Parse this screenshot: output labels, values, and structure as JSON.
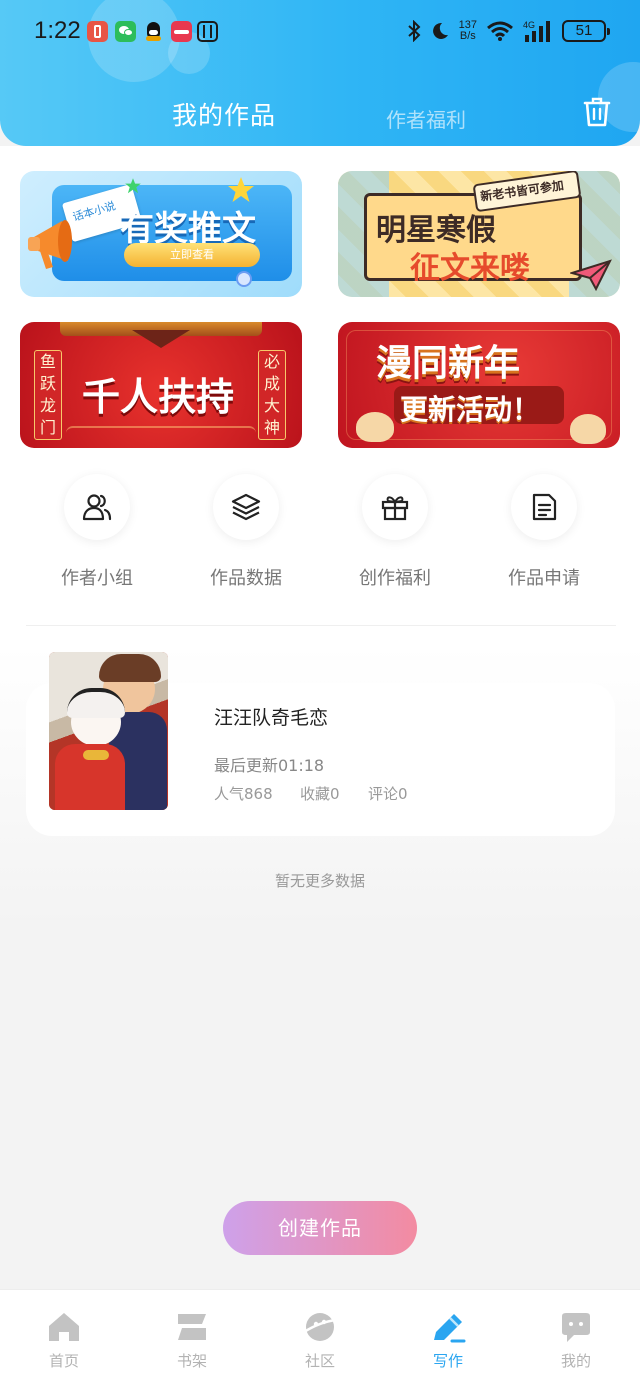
{
  "status_bar": {
    "time": "1:22",
    "net_speed_value": "137",
    "net_speed_unit": "B/s",
    "battery": "51"
  },
  "header": {
    "tabs": [
      {
        "label": "我的作品",
        "active": true
      },
      {
        "label": "作者福利",
        "active": false
      }
    ],
    "trash_icon": "trash-icon"
  },
  "banners": [
    {
      "title": "有奖推文",
      "tag": "话本小说",
      "button": "立即查看"
    },
    {
      "title_line1": "明星寒假",
      "title_line2": "征文来喽",
      "tag": "新老书皆可参加"
    },
    {
      "title": "千人扶持",
      "left_couplet": "鱼跃龙门",
      "right_couplet": "必成大神"
    },
    {
      "title_line1": "漫同新年",
      "title_line2": "更新活动！"
    }
  ],
  "quick_actions": [
    {
      "label": "作者小组",
      "icon": "users-icon"
    },
    {
      "label": "作品数据",
      "icon": "layers-icon"
    },
    {
      "label": "创作福利",
      "icon": "gift-icon"
    },
    {
      "label": "作品申请",
      "icon": "document-icon"
    }
  ],
  "work": {
    "title": "汪汪队奇毛恋",
    "last_update": "最后更新01:18",
    "popularity": "人气868",
    "favorites": "收藏0",
    "comments": "评论0"
  },
  "no_more_text": "暂无更多数据",
  "create_button": "创建作品",
  "tab_bar": [
    {
      "label": "首页",
      "icon": "home-icon"
    },
    {
      "label": "书架",
      "icon": "bookshelf-icon"
    },
    {
      "label": "社区",
      "icon": "planet-icon"
    },
    {
      "label": "写作",
      "icon": "pen-icon",
      "active": true
    },
    {
      "label": "我的",
      "icon": "chat-bubble-icon"
    }
  ],
  "colors": {
    "accent": "#2aa5f0",
    "header_start": "#56c9f6",
    "header_end": "#1fa6f1",
    "button_start": "#cea1ea",
    "button_end": "#f38ba1"
  }
}
